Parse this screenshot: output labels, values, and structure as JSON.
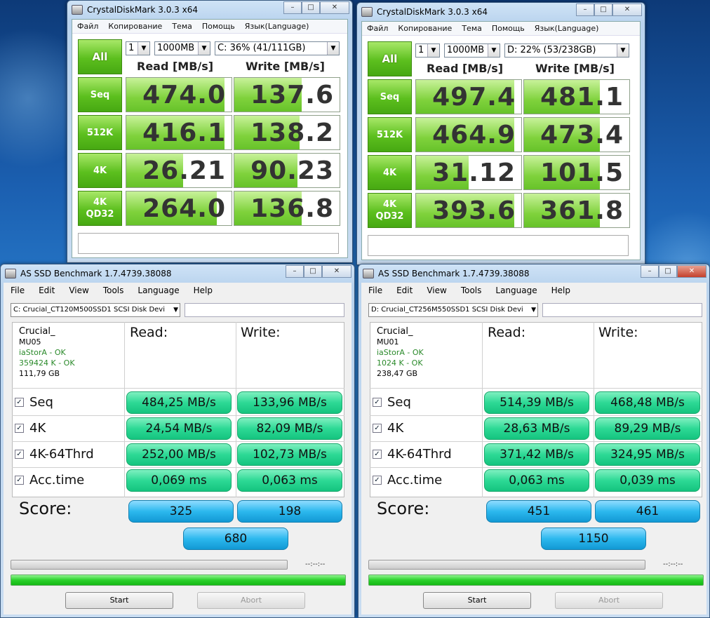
{
  "cdm": [
    {
      "title": "CrystalDiskMark 3.0.3 x64",
      "menu": [
        "Файл",
        "Копирование",
        "Тема",
        "Помощь",
        "Язык(Language)"
      ],
      "all_label": "All",
      "count": "1",
      "size": "1000MB",
      "drive": "C: 36% (41/111GB)",
      "read_header": "Read [MB/s]",
      "write_header": "Write [MB/s]",
      "rows": [
        {
          "label": "Seq",
          "label2": "",
          "read": "474.0",
          "write": "137.6",
          "read_fill": 0.93,
          "write_fill": 0.64
        },
        {
          "label": "512K",
          "label2": "",
          "read": "416.1",
          "write": "138.2",
          "read_fill": 0.93,
          "write_fill": 0.62
        },
        {
          "label": "4K",
          "label2": "",
          "read": "26.21",
          "write": "90.23",
          "read_fill": 0.54,
          "write_fill": 0.6
        },
        {
          "label": "4K",
          "label2": "QD32",
          "read": "264.0",
          "write": "136.8",
          "read_fill": 0.86,
          "write_fill": 0.64
        }
      ]
    },
    {
      "title": "CrystalDiskMark 3.0.3 x64",
      "menu": [
        "Файл",
        "Копирование",
        "Тема",
        "Помощь",
        "Язык(Language)"
      ],
      "all_label": "All",
      "count": "1",
      "size": "1000MB",
      "drive": "D: 22% (53/238GB)",
      "read_header": "Read [MB/s]",
      "write_header": "Write [MB/s]",
      "rows": [
        {
          "label": "Seq",
          "label2": "",
          "read": "497.4",
          "write": "481.1",
          "read_fill": 0.93,
          "write_fill": 0.72
        },
        {
          "label": "512K",
          "label2": "",
          "read": "464.9",
          "write": "473.4",
          "read_fill": 0.93,
          "write_fill": 0.72
        },
        {
          "label": "4K",
          "label2": "",
          "read": "31.12",
          "write": "101.5",
          "read_fill": 0.5,
          "write_fill": 0.72
        },
        {
          "label": "4K",
          "label2": "QD32",
          "read": "393.6",
          "write": "361.8",
          "read_fill": 0.93,
          "write_fill": 0.72
        }
      ]
    }
  ],
  "asssd": [
    {
      "title": "AS SSD Benchmark 1.7.4739.38088",
      "menu": [
        "File",
        "Edit",
        "View",
        "Tools",
        "Language",
        "Help"
      ],
      "drive_select": "C: Crucial_CT120M500SSD1 SCSI Disk Devi",
      "info": {
        "model": "Crucial_",
        "fw": "MU05",
        "driver": "iaStorA - OK",
        "align": "359424 K - OK",
        "size": "111,79 GB"
      },
      "read_header": "Read:",
      "write_header": "Write:",
      "rows": [
        {
          "label": "Seq",
          "read": "484,25 MB/s",
          "write": "133,96 MB/s"
        },
        {
          "label": "4K",
          "read": "24,54 MB/s",
          "write": "82,09 MB/s"
        },
        {
          "label": "4K-64Thrd",
          "read": "252,00 MB/s",
          "write": "102,73 MB/s"
        },
        {
          "label": "Acc.time",
          "read": "0,069 ms",
          "write": "0,063 ms"
        }
      ],
      "score_label": "Score:",
      "score_read": "325",
      "score_write": "198",
      "score_total": "680",
      "timer": "--:--:--",
      "start": "Start",
      "abort": "Abort"
    },
    {
      "title": "AS SSD Benchmark 1.7.4739.38088",
      "menu": [
        "File",
        "Edit",
        "View",
        "Tools",
        "Language",
        "Help"
      ],
      "drive_select": "D: Crucial_CT256M550SSD1 SCSI Disk Devi",
      "info": {
        "model": "Crucial_",
        "fw": "MU01",
        "driver": "iaStorA - OK",
        "align": "1024 K - OK",
        "size": "238,47 GB"
      },
      "read_header": "Read:",
      "write_header": "Write:",
      "rows": [
        {
          "label": "Seq",
          "read": "514,39 MB/s",
          "write": "468,48 MB/s"
        },
        {
          "label": "4K",
          "read": "28,63 MB/s",
          "write": "89,29 MB/s"
        },
        {
          "label": "4K-64Thrd",
          "read": "371,42 MB/s",
          "write": "324,95 MB/s"
        },
        {
          "label": "Acc.time",
          "read": "0,063 ms",
          "write": "0,039 ms"
        }
      ],
      "score_label": "Score:",
      "score_read": "451",
      "score_write": "461",
      "score_total": "1150",
      "timer": "--:--:--",
      "start": "Start",
      "abort": "Abort"
    }
  ]
}
